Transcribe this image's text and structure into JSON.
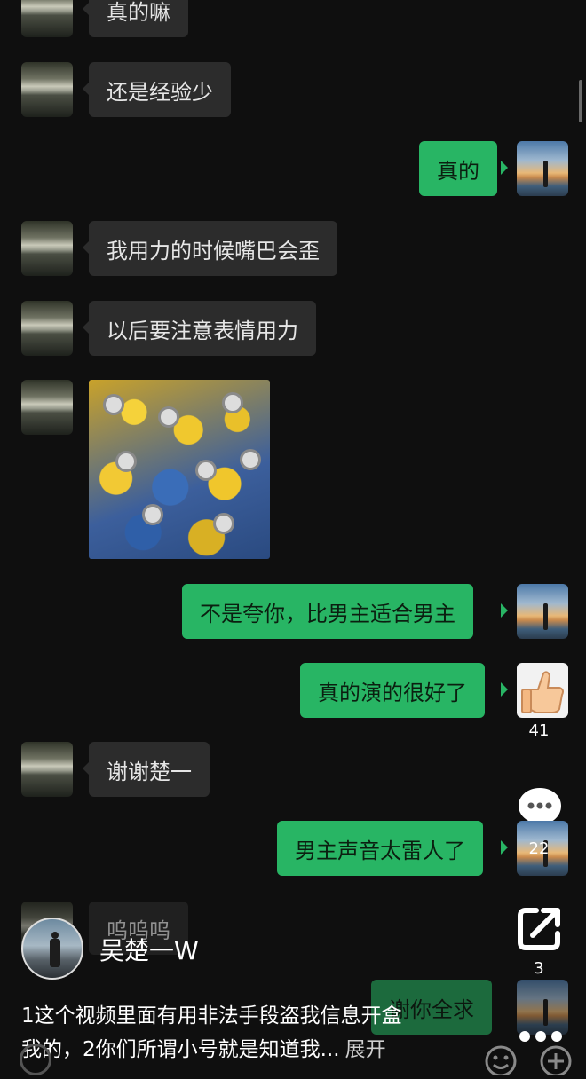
{
  "messages": [
    {
      "side": "in",
      "text": "真的嘛"
    },
    {
      "side": "in",
      "text": "还是经验少"
    },
    {
      "side": "out",
      "text": "真的"
    },
    {
      "side": "in",
      "text": "我用力的时候嘴巴会歪"
    },
    {
      "side": "in",
      "text": "以后要注意表情用力"
    },
    {
      "side": "in",
      "text": "[minions image]"
    },
    {
      "side": "out",
      "text": "不是夸你，比男主适合男主"
    },
    {
      "side": "out",
      "text": "真的演的很好了"
    },
    {
      "side": "in",
      "text": "谢谢楚一"
    },
    {
      "side": "out",
      "text": "男主声音太雷人了"
    },
    {
      "side": "in",
      "text": "呜呜呜"
    },
    {
      "side": "out",
      "text": "谢你全求"
    }
  ],
  "overlay": {
    "like_count": "41",
    "comment_count": "22",
    "share_count": "3",
    "author_name": "吴楚一W",
    "caption_line1": "1这个视频里面有用非法手段盗我信息开盒",
    "caption_line2": "我的，2你们所谓小号就是知道我...",
    "expand_label": "展开"
  },
  "icons": [
    "thumbs-up-icon",
    "comment-icon",
    "share-icon",
    "more-icon",
    "emoji-icon",
    "plus-icon",
    "voice-icon",
    "scrollbar"
  ],
  "colors": {
    "background": "#0f0f0f",
    "incoming_bubble": "#2c2c2c",
    "outgoing_bubble": "#28b564"
  }
}
